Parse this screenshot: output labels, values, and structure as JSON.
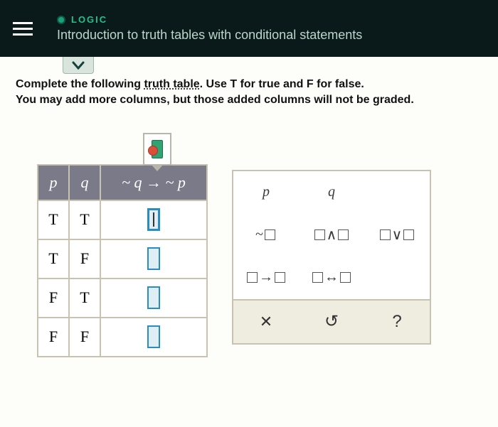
{
  "header": {
    "category": "LOGIC",
    "title": "Introduction to truth tables with conditional statements"
  },
  "instructions": {
    "line1_pre": "Complete the following ",
    "line1_link": "truth table",
    "line1_post": ". Use T for true and F for false.",
    "line2": "You may add more columns, but those added columns will not be graded."
  },
  "table": {
    "headers": {
      "p": "p",
      "q": "q",
      "expr": "~ q → ~ p"
    },
    "rows": [
      {
        "p": "T",
        "q": "T"
      },
      {
        "p": "T",
        "q": "F"
      },
      {
        "p": "F",
        "q": "T"
      },
      {
        "p": "F",
        "q": "F"
      }
    ]
  },
  "palette": {
    "p": "p",
    "q": "q",
    "not": "~",
    "and": "∧",
    "or": "∨",
    "cond": "→",
    "bicond": "↔",
    "clear": "✕",
    "undo": "↺",
    "help": "?"
  }
}
